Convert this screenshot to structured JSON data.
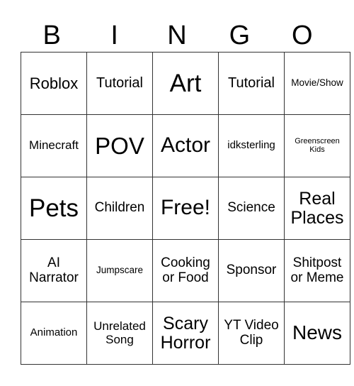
{
  "header": [
    "B",
    "I",
    "N",
    "G",
    "O"
  ],
  "rows": [
    [
      "Roblox",
      "Tutorial",
      "Art",
      "Tutorial",
      "Movie/Show"
    ],
    [
      "Minecraft",
      "POV",
      "Actor",
      "idksterling",
      "Greenscreen Kids"
    ],
    [
      "Pets",
      "Children",
      "Free!",
      "Science",
      "Real Places"
    ],
    [
      "AI Narrator",
      "Jumpscare",
      "Cooking or Food",
      "Sponsor",
      "Shitpost or Meme"
    ],
    [
      "Animation",
      "Unrelated Song",
      "Scary Horror",
      "YT Video Clip",
      "News"
    ]
  ]
}
